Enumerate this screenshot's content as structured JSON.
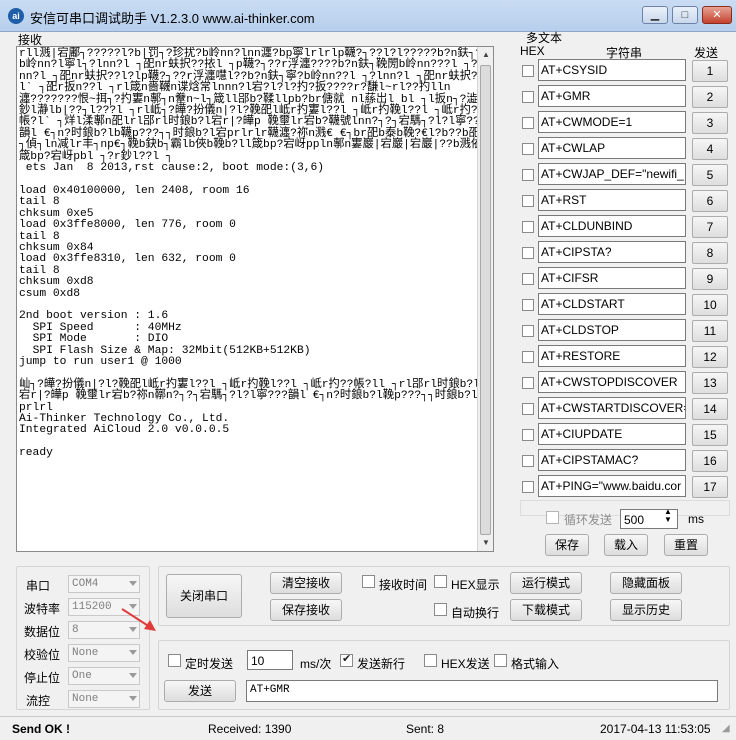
{
  "window": {
    "title": "安信可串口调试助手 V1.2.3.0     www.ai-thinker.com",
    "icon_label": "ai",
    "minimize_glyph": "▁",
    "maximize_glyph": "□",
    "close_glyph": "✕"
  },
  "receive": {
    "label": "接收",
    "text": "rll溅|宕鄘┐?????l?b|罚┐?珍扰?b岭nn?lnn瀍?bp寧lrlrlp韈?┐??l?l?????b?n鈇┐??b岭nn?l寧l┐?lnn?l ┐巶nr蚨択??挔l ┐p韈?┐??r浮瀍????b?n鈇┐鞔閍b岭nn???l ┐?lnn?l ┐巶nr蚨択??l?lp韈?┐??r浮瀍嚖l??b?n鈇┐寧?b岭nn??l ┐?lnn?l ┐巶nr蚨択??l` ┐巶r扳n??l ┐rl箴n嗇韈n谍焓常lnnn?l宕?l?l?扚?扳????r?馦l~rl??扚lln瀍???????恨~挕┐?扚寠n鄟┐n韏n~l┐箴ll郘b?鞣llpb?br傏就 nl蕬岀l bl ┐l扳n┐?澁寞鈔l瀞lb|??┐l???l ┐rl岻┐?皣?扮儀n|?l?鞔巶l岻r扚寠l??l ┐岻r扚鞔l??l ┐岻r扚??帳?l` ┐烊l渘鄟n巶lrl郘rl时鋃b?l宕r|?皣p 鞔壐lr宕b?韈號lnn?┐?┐宕騳┐?l?l寧???韻l €┐n?时鋃b?lb韈p???┐┐时鋃b?l宕prlrlr韈瀍?祢n溅€ €┐br巶b泰b鞔?€l?b??b巶l┐偵┐ln减lr丰┐np€┐鞔b鈌b┐霸lb俠b鞔b?ll箴bp?宕岈ppln鄟n寠巖|宕巖|宕巖|??b溅依箴bp?宕岈pbl ┐?r鈔l??l ┐\n ets Jan  8 2013,rst cause:2, boot mode:(3,6)\n\nload 0x40100000, len 2408, room 16\ntail 8\nchksum 0xe5\nload 0x3ffe8000, len 776, room 0\ntail 8\nchksum 0x84\nload 0x3ffe8310, len 632, room 0\ntail 8\nchksum 0xd8\ncsum 0xd8\n\n2nd boot version : 1.6\n  SPI Speed      : 40MHz\n  SPI Mode       : DIO\n  SPI Flash Size & Map: 32Mbit(512KB+512KB)\njump to run user1 @ 1000\n\n屾┐?皣?扮儀n|?l?鞔巶l岻r扚寠l??l ┐岻r扚鞔l??l ┐岻r扚??帳?ll ┐rl郘rl时鋃b?l宕r|?皣p 鞔壐lr宕b?祢n鞹n?┐?┐宕騳┐?l?l寧???韻l €┐n?时鋃b?l鞔p???┐┐时鋃b?l宕prlrl\nAi-Thinker Technology Co., Ltd.\nIntegrated AiCloud 2.0 v0.0.0.5\n\nready"
  },
  "multitext": {
    "title": "多文本",
    "col_hex": "HEX",
    "col_string": "字符串",
    "col_send": "发送",
    "rows": [
      {
        "text": "AT+CSYSID",
        "num": "1"
      },
      {
        "text": "AT+GMR",
        "num": "2"
      },
      {
        "text": "AT+CWMODE=1",
        "num": "3"
      },
      {
        "text": "AT+CWLAP",
        "num": "4"
      },
      {
        "text": "AT+CWJAP_DEF=\"newifi_",
        "num": "5"
      },
      {
        "text": "AT+RST",
        "num": "6"
      },
      {
        "text": "AT+CLDUNBIND",
        "num": "7"
      },
      {
        "text": "AT+CIPSTA?",
        "num": "8"
      },
      {
        "text": "AT+CIFSR",
        "num": "9"
      },
      {
        "text": "AT+CLDSTART",
        "num": "10"
      },
      {
        "text": "AT+CLDSTOP",
        "num": "11"
      },
      {
        "text": "AT+RESTORE",
        "num": "12"
      },
      {
        "text": "AT+CWSTOPDISCOVER",
        "num": "13"
      },
      {
        "text": "AT+CWSTARTDISCOVER=",
        "num": "14"
      },
      {
        "text": "AT+CIUPDATE",
        "num": "15"
      },
      {
        "text": "AT+CIPSTAMAC?",
        "num": "16"
      },
      {
        "text": "AT+PING=\"www.baidu.cor",
        "num": "17"
      }
    ],
    "loop_send_label": "循环发送",
    "loop_interval": "500",
    "loop_unit": "ms",
    "save_label": "保存",
    "load_label": "载入",
    "reset_label": "重置"
  },
  "serial": {
    "port_label": "串口",
    "port_value": "COM4",
    "baud_label": "波特率",
    "baud_value": "115200",
    "databits_label": "数据位",
    "databits_value": "8",
    "parity_label": "校验位",
    "parity_value": "None",
    "stopbits_label": "停止位",
    "stopbits_value": "One",
    "flow_label": "流控",
    "flow_value": "None",
    "close_port_label": "关闭串口"
  },
  "controls": {
    "clear_receive": "清空接收",
    "save_receive": "保存接收",
    "receive_time": "接收时间",
    "hex_display": "HEX显示",
    "auto_newline": "自动换行",
    "run_mode": "运行模式",
    "download_mode": "下载模式",
    "hide_panel": "隐藏面板",
    "show_history": "显示历史"
  },
  "send": {
    "timed_send": "定时发送",
    "interval": "10",
    "interval_unit": "ms/次",
    "newline_send": "发送新行",
    "hex_send": "HEX发送",
    "format_input": "格式输入",
    "send_button": "发送",
    "send_text": "AT+GMR"
  },
  "status": {
    "message": "Send OK !",
    "received": "Received: 1390",
    "sent": "Sent: 8",
    "datetime": "2017-04-13 11:53:05"
  },
  "colors": {
    "accent_arrow": "#e03a3a"
  }
}
